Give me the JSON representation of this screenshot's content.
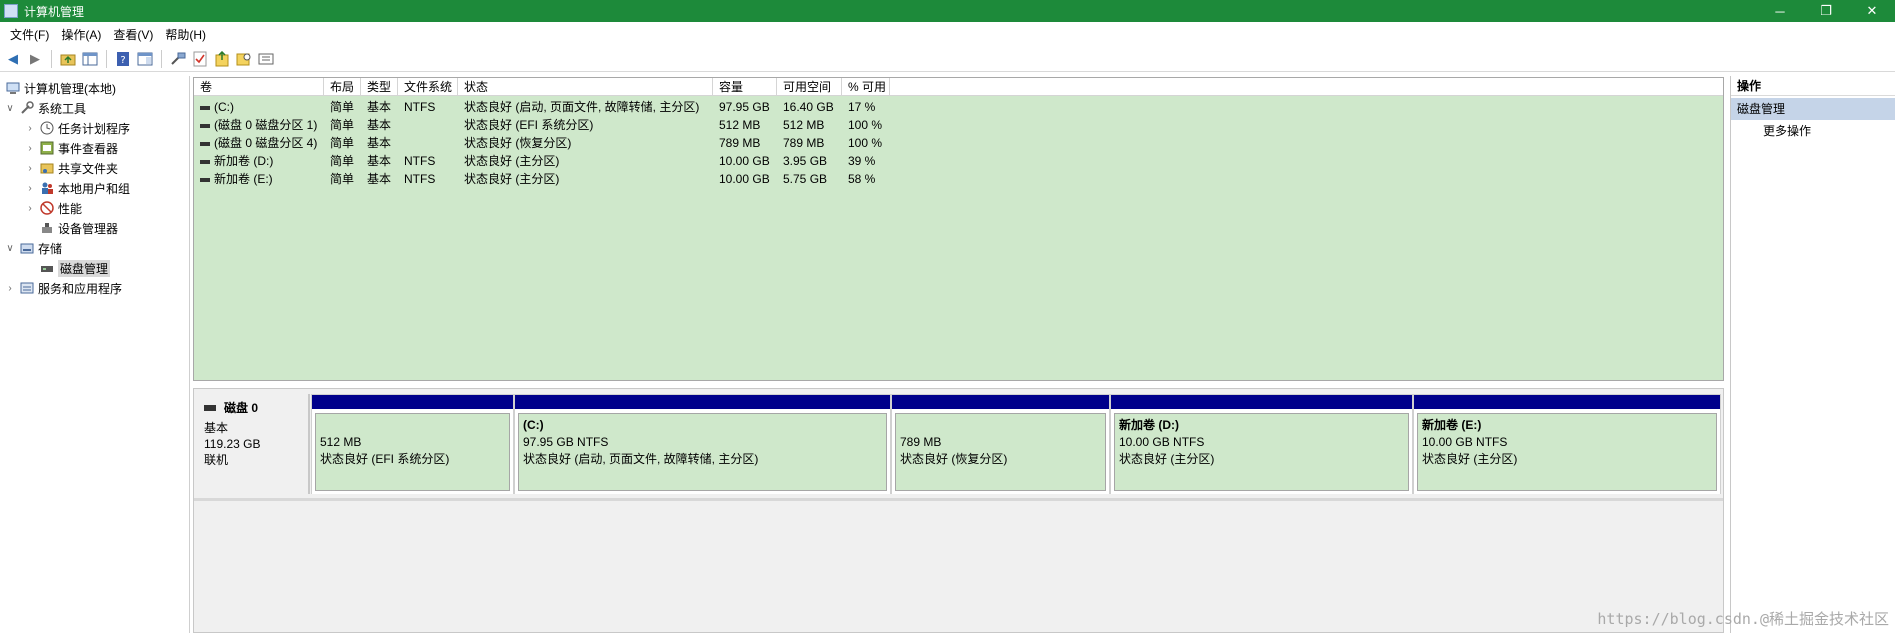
{
  "window": {
    "title": "计算机管理",
    "min_glyph": "─",
    "restore_glyph": "❐",
    "close_glyph": "✕"
  },
  "menu": [
    "文件(F)",
    "操作(A)",
    "查看(V)",
    "帮助(H)"
  ],
  "toolbar": {
    "icons": [
      "back-icon",
      "forward-icon",
      "up-folder-icon",
      "show-hide-tree-icon",
      "help-icon",
      "properties-pane-icon",
      "connect-icon",
      "check-icon",
      "export-icon",
      "search-icon",
      "view-list-icon"
    ]
  },
  "tree": {
    "root": "计算机管理(本地)",
    "system_tools": "系统工具",
    "task_scheduler": "任务计划程序",
    "event_viewer": "事件查看器",
    "shared_folders": "共享文件夹",
    "local_users": "本地用户和组",
    "performance": "性能",
    "device_manager": "设备管理器",
    "storage": "存储",
    "disk_management": "磁盘管理",
    "services_apps": "服务和应用程序"
  },
  "volume_list": {
    "columns": [
      "卷",
      "布局",
      "类型",
      "文件系统",
      "状态",
      "容量",
      "可用空间",
      "% 可用"
    ],
    "rows": [
      {
        "volume": "(C:)",
        "layout": "简单",
        "type": "基本",
        "fs": "NTFS",
        "status": "状态良好 (启动, 页面文件, 故障转储, 主分区)",
        "capacity": "97.95 GB",
        "free": "16.40 GB",
        "pct": "17 %"
      },
      {
        "volume": "(磁盘 0 磁盘分区 1)",
        "layout": "简单",
        "type": "基本",
        "fs": "",
        "status": "状态良好 (EFI 系统分区)",
        "capacity": "512 MB",
        "free": "512 MB",
        "pct": "100 %"
      },
      {
        "volume": "(磁盘 0 磁盘分区 4)",
        "layout": "简单",
        "type": "基本",
        "fs": "",
        "status": "状态良好 (恢复分区)",
        "capacity": "789 MB",
        "free": "789 MB",
        "pct": "100 %"
      },
      {
        "volume": "新加卷 (D:)",
        "layout": "简单",
        "type": "基本",
        "fs": "NTFS",
        "status": "状态良好 (主分区)",
        "capacity": "10.00 GB",
        "free": "3.95 GB",
        "pct": "39 %"
      },
      {
        "volume": "新加卷 (E:)",
        "layout": "简单",
        "type": "基本",
        "fs": "NTFS",
        "status": "状态良好 (主分区)",
        "capacity": "10.00 GB",
        "free": "5.75 GB",
        "pct": "58 %"
      }
    ]
  },
  "disk": {
    "name": "磁盘 0",
    "type": "基本",
    "size": "119.23 GB",
    "state": "联机",
    "partitions": [
      {
        "name": "",
        "size": "512 MB",
        "status": "状态良好 (EFI 系统分区)"
      },
      {
        "name": "(C:)",
        "size": "97.95 GB NTFS",
        "status": "状态良好 (启动, 页面文件, 故障转储, 主分区)"
      },
      {
        "name": "",
        "size": "789 MB",
        "status": "状态良好 (恢复分区)"
      },
      {
        "name": "新加卷  (D:)",
        "size": "10.00 GB NTFS",
        "status": "状态良好 (主分区)"
      },
      {
        "name": "新加卷  (E:)",
        "size": "10.00 GB NTFS",
        "status": "状态良好 (主分区)"
      }
    ]
  },
  "actions": {
    "header": "操作",
    "section": "磁盘管理",
    "more": "更多操作"
  },
  "watermark": "https://blog.csdn.@稀土掘金技术社区"
}
